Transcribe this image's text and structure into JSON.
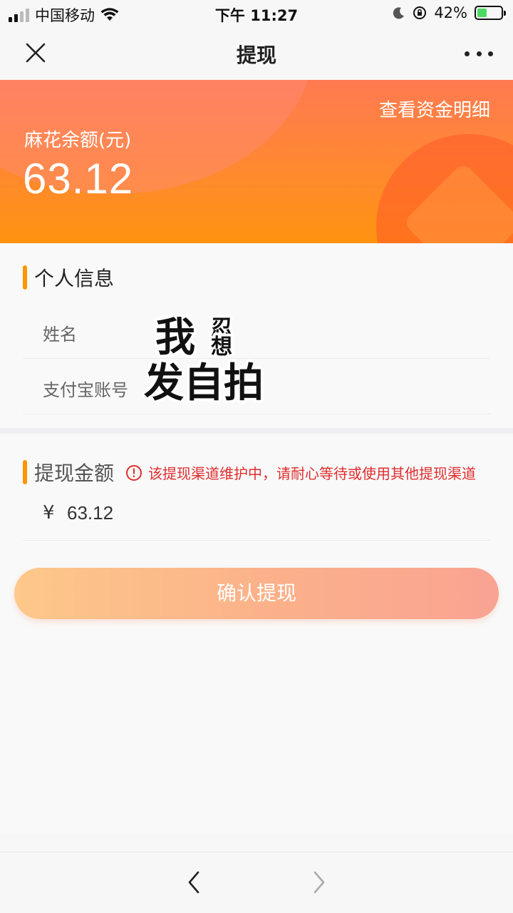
{
  "status_bar": {
    "carrier": "中国移动",
    "time": "下午 11:27",
    "battery_percent": "42%",
    "battery_level": 0.42
  },
  "navbar": {
    "title": "提现",
    "close_icon": "close-icon",
    "more_icon": "more-dots-icon"
  },
  "banner": {
    "detail_link": "查看资金明细",
    "balance_label": "麻花余额(元)",
    "balance_value": "63.12"
  },
  "personal_info": {
    "title": "个人信息",
    "name_label": "姓名",
    "alipay_label": "支付宝账号"
  },
  "withdraw": {
    "title": "提现金额",
    "warning": "该提现渠道维护中，请耐心等待或使用其他提现渠道",
    "currency": "¥",
    "amount": "63.12",
    "confirm_label": "确认提现"
  },
  "sticker": {
    "line1": "我想",
    "line2": "发自拍"
  },
  "colors": {
    "accent": "#ff9500",
    "warning": "#e02d2d",
    "banner_start": "#ff7a52",
    "banner_end": "#ff930f"
  }
}
